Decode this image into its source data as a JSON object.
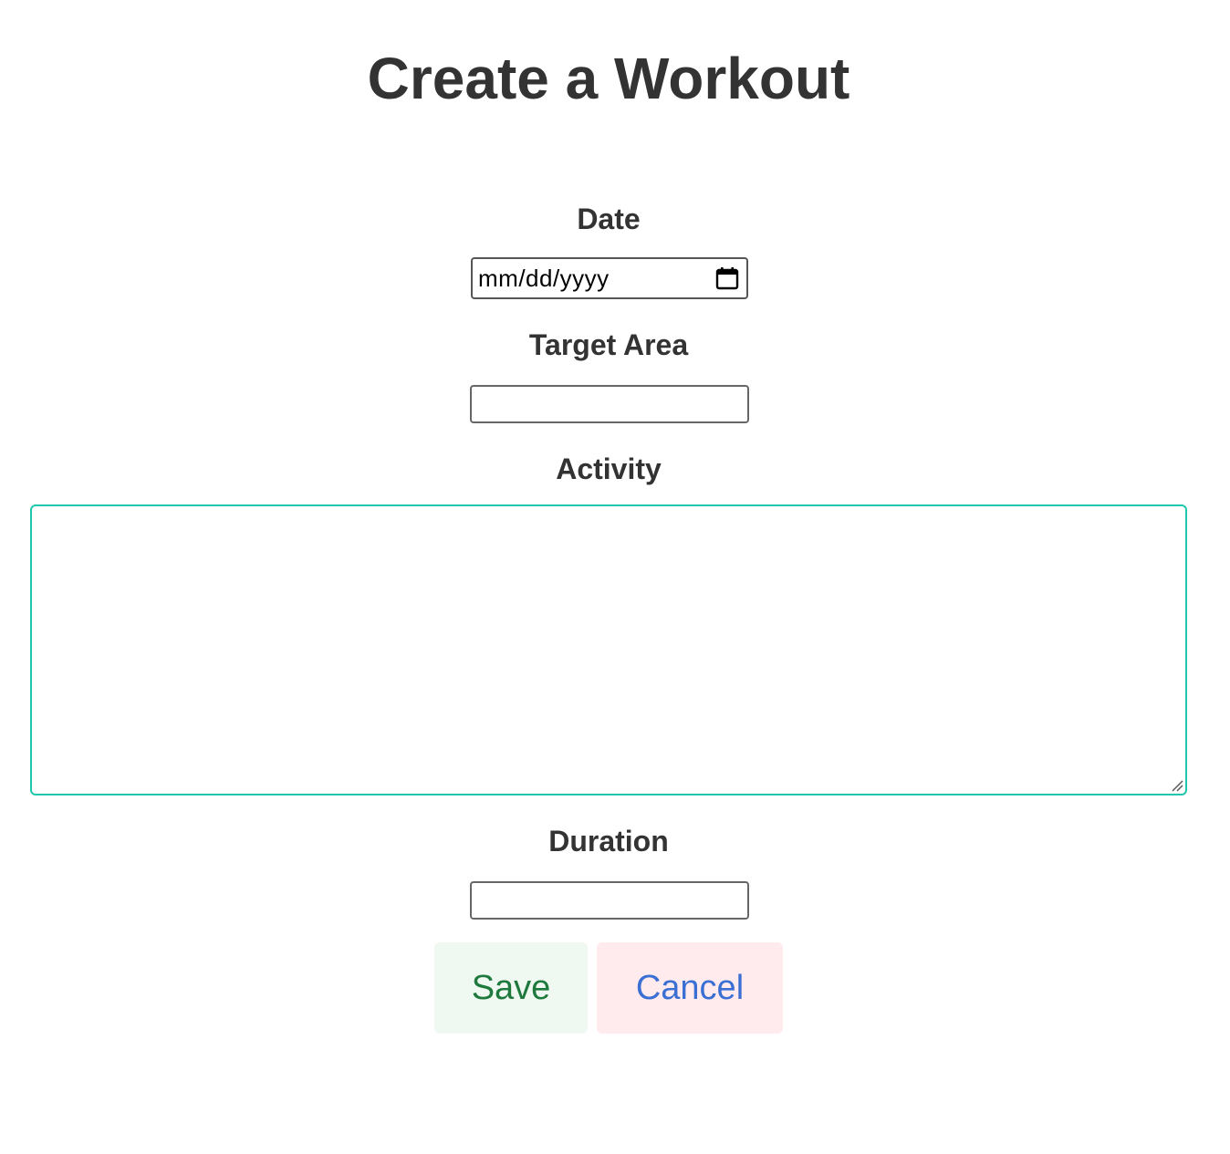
{
  "page": {
    "title": "Create a Workout"
  },
  "form": {
    "date": {
      "label": "Date",
      "placeholder": "mm/dd/yyyy",
      "icon": "calendar-icon"
    },
    "target_area": {
      "label": "Target Area",
      "value": ""
    },
    "activity": {
      "label": "Activity",
      "value": ""
    },
    "duration": {
      "label": "Duration",
      "value": ""
    }
  },
  "actions": {
    "save_label": "Save",
    "cancel_label": "Cancel"
  },
  "colors": {
    "text": "#333333",
    "focus_border": "#1fc7ad",
    "save_bg": "#eff8f1",
    "save_text": "#1e7a3c",
    "cancel_bg": "#ffebee",
    "cancel_text": "#3a6fd4"
  }
}
